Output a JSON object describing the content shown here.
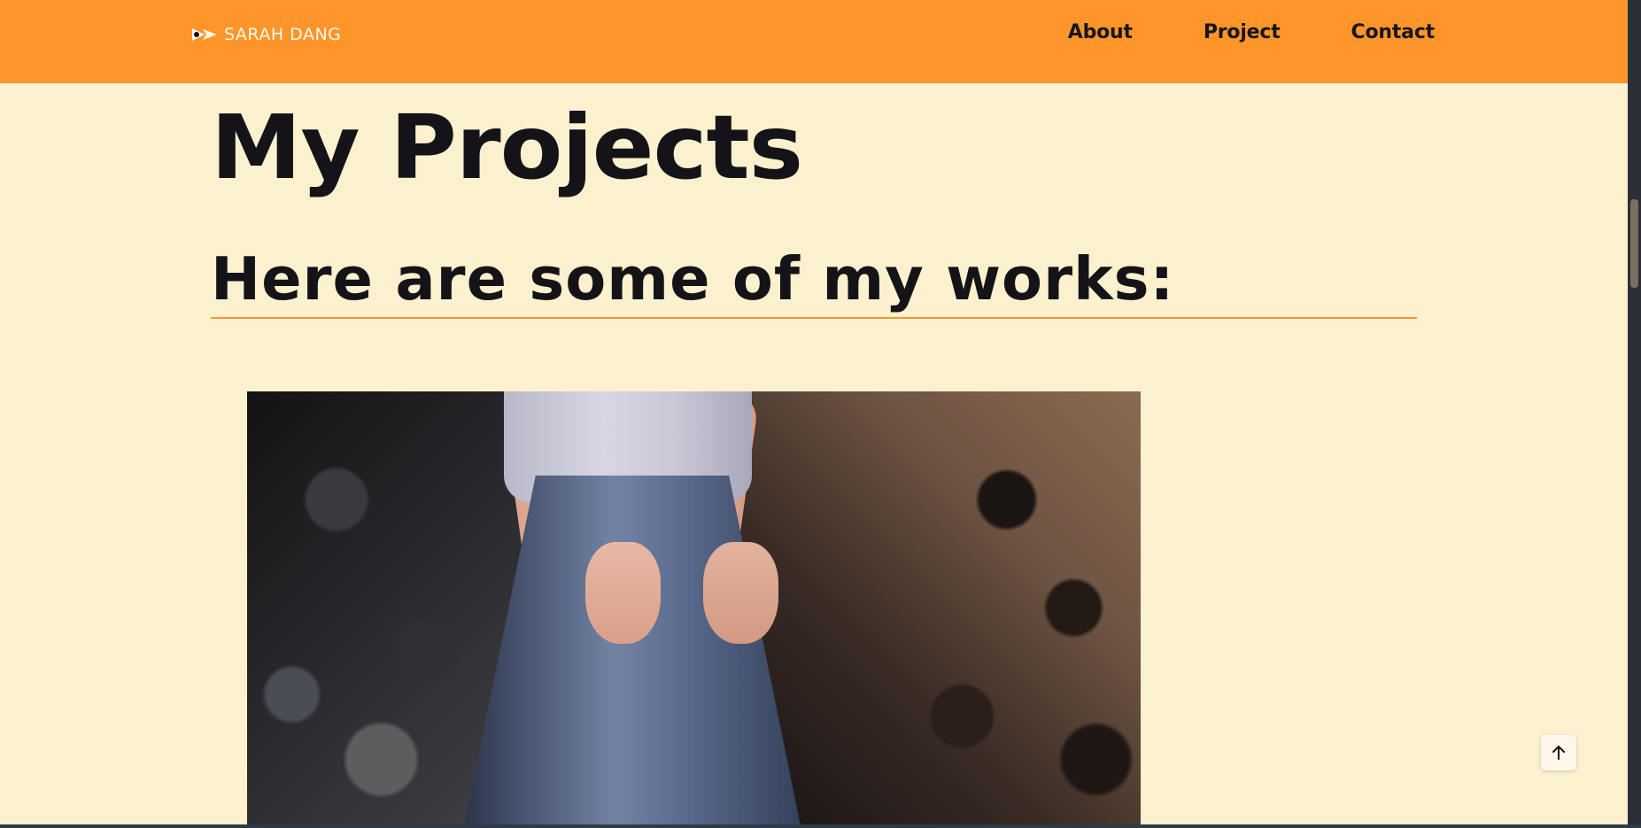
{
  "header": {
    "brand_name": "SARAH DANG",
    "brand_icon": "arrow-logo-icon",
    "nav": [
      {
        "label": "About"
      },
      {
        "label": "Project"
      },
      {
        "label": "Contact"
      }
    ],
    "background_color": "#fe952b"
  },
  "main": {
    "title": "My Projects",
    "subtitle": "Here are some of my works:",
    "project_image": {
      "description_icon": "project-photo"
    }
  },
  "back_to_top": {
    "icon": "arrow-up-icon"
  },
  "colors": {
    "page_background": "#fbf1cf",
    "accent": "#fe952b",
    "text": "#141317"
  }
}
